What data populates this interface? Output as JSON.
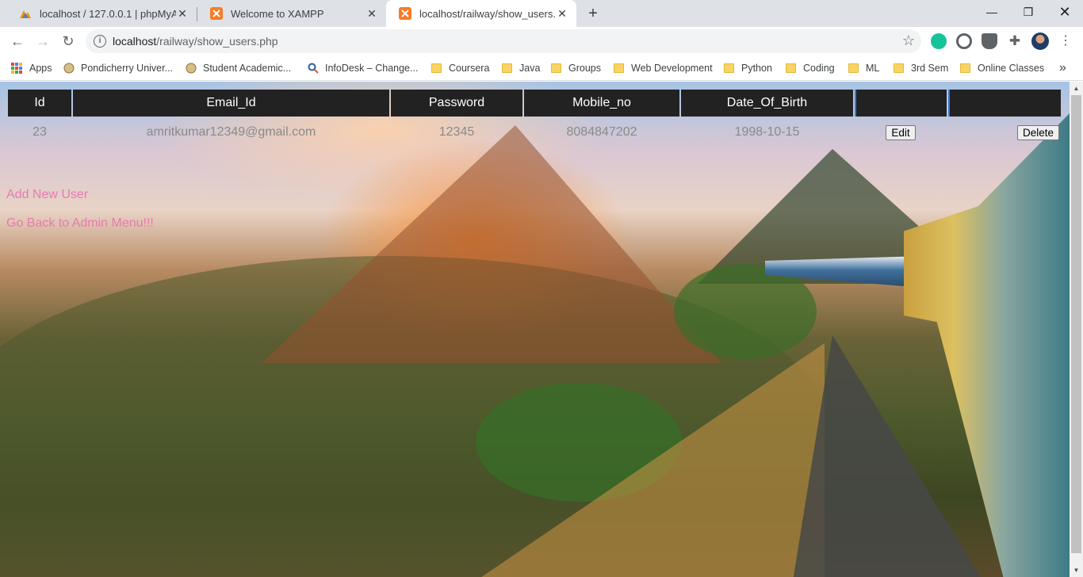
{
  "browser": {
    "tabs": [
      {
        "title": "localhost / 127.0.0.1 | phpMyAdmin",
        "favicon": "phpmyadmin-icon",
        "active": false
      },
      {
        "title": "Welcome to XAMPP",
        "favicon": "xampp-icon",
        "active": false
      },
      {
        "title": "localhost/railway/show_users.php",
        "favicon": "xampp-icon",
        "active": true
      }
    ],
    "url_host": "localhost",
    "url_path": "/railway/show_users.php",
    "bookmarks": [
      {
        "label": "Apps",
        "icon": "apps-icon"
      },
      {
        "label": "Pondicherry Univer...",
        "icon": "site-icon"
      },
      {
        "label": "Student Academic...",
        "icon": "site-icon"
      },
      {
        "label": "InfoDesk – Change...",
        "icon": "site-icon"
      },
      {
        "label": "Coursera",
        "icon": "folder-icon"
      },
      {
        "label": "Java",
        "icon": "folder-icon"
      },
      {
        "label": "Groups",
        "icon": "folder-icon"
      },
      {
        "label": "Web Development",
        "icon": "folder-icon"
      },
      {
        "label": "Python",
        "icon": "folder-icon"
      },
      {
        "label": "Coding",
        "icon": "folder-icon"
      },
      {
        "label": "ML",
        "icon": "folder-icon"
      },
      {
        "label": "3rd Sem",
        "icon": "folder-icon"
      },
      {
        "label": "Online Classes",
        "icon": "folder-icon"
      }
    ],
    "more_bookmarks": "»"
  },
  "table": {
    "headers": [
      "Id",
      "Email_Id",
      "Password",
      "Mobile_no",
      "Date_Of_Birth",
      "",
      ""
    ],
    "rows": [
      {
        "id": "23",
        "email": "amritkumar12349@gmail.com",
        "password": "12345",
        "mobile": "8084847202",
        "dob": "1998-10-15",
        "edit_label": "Edit",
        "delete_label": "Delete"
      }
    ]
  },
  "links": {
    "add_user": "Add New User",
    "back_admin": "Go Back to Admin Menu!!!"
  },
  "colors": {
    "header_bg": "#222222",
    "link": "#e77bb0",
    "cell_text": "#8a8a8a"
  }
}
